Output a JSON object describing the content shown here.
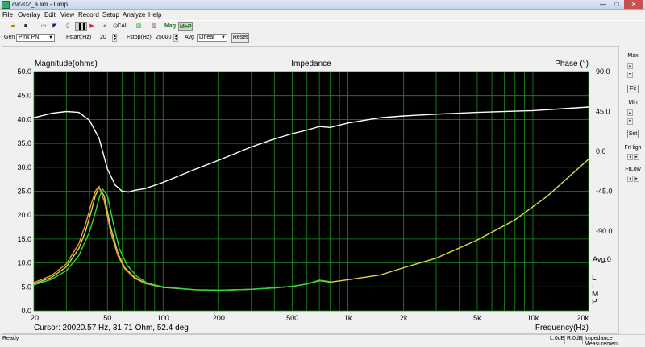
{
  "window": {
    "title": "cw202_a.lim - Limp",
    "min": "—",
    "max": "□",
    "close": "✕"
  },
  "menu": [
    "File",
    "Overlay",
    "Edit",
    "View",
    "Record",
    "Setup",
    "Analyze",
    "Help"
  ],
  "toolbar": {
    "cal": "CAL",
    "mag": "Mag",
    "mp": "M+P",
    "stop": "▐▐",
    "play": "▶",
    "rec": "●"
  },
  "gen": {
    "gen_label": "Gen",
    "gen_value": "Pink PN",
    "fstart_label": "Fstart(Hz)",
    "fstart_value": "20",
    "fstop_label": "Fstop(Hz)",
    "fstop_value": "25000",
    "avg_label": "Avg",
    "avg_value": "Linear",
    "reset": "Reset"
  },
  "side": {
    "max": "Max",
    "fit": "Fit",
    "min": "Min",
    "set": "Set",
    "frhigh": "FrHigh",
    "frlow": "FrLow",
    "up": "▲",
    "down": "▼"
  },
  "status": {
    "ready": "Ready",
    "l": "L:0dB",
    "r": "R:0dB",
    "mode": "Impedance Measuremen"
  },
  "plot": {
    "cursor": "Cursor: 20020.57 Hz, 31.71 Ohm, 52.4 deg",
    "avg": "Avg:0",
    "limp": [
      "L",
      "I",
      "M",
      "P"
    ]
  },
  "chart_data": {
    "type": "line",
    "title": "Impedance",
    "xlabel": "Frequency(Hz)",
    "ylabel": "Magnitude(ohms)",
    "y2label": "Phase (°)",
    "xscale": "log",
    "xlim": [
      20,
      20000
    ],
    "ylim": [
      0,
      50
    ],
    "y2lim": [
      -180,
      90
    ],
    "xticks": [
      20,
      50,
      100,
      200,
      500,
      1000,
      2000,
      5000,
      10000,
      20000
    ],
    "xticklabels": [
      "20",
      "50",
      "100",
      "200",
      "500",
      "1k",
      "2k",
      "5k",
      "10k",
      "20k"
    ],
    "yticks": [
      0,
      5,
      10,
      15,
      20,
      25,
      30,
      35,
      40,
      45,
      50
    ],
    "yticklabels": [
      "0.0",
      "5.0",
      "10.0",
      "15.0",
      "20.0",
      "25.0",
      "30.0",
      "35.0",
      "40.0",
      "45.0",
      "50.0"
    ],
    "y2ticks": [
      90,
      45,
      0,
      -45,
      -90
    ],
    "y2ticklabels": [
      "90.0",
      "45.0",
      "0.0",
      "-45.0",
      "-90.0"
    ],
    "grid": true,
    "colors": {
      "background": "#000000",
      "grid": "#1f8a1f",
      "yellow": "#d8d84a",
      "orange": "#e89a3a",
      "green": "#2ed83a",
      "white": "#ffffff"
    },
    "series": [
      {
        "color": "yellow",
        "x": [
          20,
          25,
          30,
          35,
          38,
          41,
          43,
          45,
          48,
          52,
          57,
          62,
          70,
          80,
          100,
          150,
          200,
          300,
          400,
          500,
          600,
          700,
          800,
          1000,
          1500,
          2000,
          3000,
          5000,
          8000,
          12000,
          20000
        ],
        "y": [
          5.6,
          7.0,
          9.2,
          13.0,
          16.5,
          21.0,
          24.0,
          25.8,
          24.0,
          17.5,
          12.0,
          9.0,
          7.0,
          5.8,
          4.9,
          4.4,
          4.3,
          4.5,
          4.8,
          5.1,
          5.6,
          6.3,
          6.0,
          6.5,
          7.5,
          9.0,
          11.0,
          14.8,
          19.0,
          24.0,
          31.7
        ]
      },
      {
        "color": "orange",
        "x": [
          20,
          25,
          30,
          35,
          38,
          41,
          43,
          45,
          48,
          52,
          57,
          62,
          70,
          80,
          100
        ],
        "y": [
          5.9,
          7.4,
          9.8,
          14.0,
          18.0,
          22.5,
          25.0,
          26.0,
          23.0,
          16.5,
          11.5,
          8.8,
          6.8,
          5.7,
          4.9
        ]
      },
      {
        "color": "green",
        "x": [
          20,
          25,
          30,
          35,
          40,
          43,
          45,
          47,
          50,
          54,
          58,
          64,
          72,
          82,
          100,
          150,
          200,
          300,
          400,
          500,
          600,
          700,
          800
        ],
        "y": [
          5.4,
          6.6,
          8.4,
          11.5,
          16.5,
          20.5,
          23.5,
          25.5,
          24.0,
          18.0,
          13.0,
          9.5,
          7.2,
          5.8,
          5.0,
          4.4,
          4.3,
          4.5,
          4.8,
          5.1,
          5.6,
          6.4,
          6.1
        ]
      },
      {
        "color": "white",
        "axis": "phase",
        "x": [
          20,
          25,
          30,
          35,
          40,
          45,
          50,
          55,
          60,
          65,
          70,
          80,
          100,
          150,
          200,
          300,
          400,
          500,
          600,
          700,
          800,
          1000,
          1500,
          2000,
          3000,
          5000,
          10000,
          20000
        ],
        "y": [
          38,
          43,
          45,
          44,
          35,
          15,
          -20,
          -38,
          -45,
          -46,
          -44,
          -42,
          -35,
          -20,
          -10,
          5,
          14,
          20,
          24,
          28,
          27,
          32,
          38,
          40,
          42,
          44,
          46,
          50
        ]
      }
    ]
  }
}
